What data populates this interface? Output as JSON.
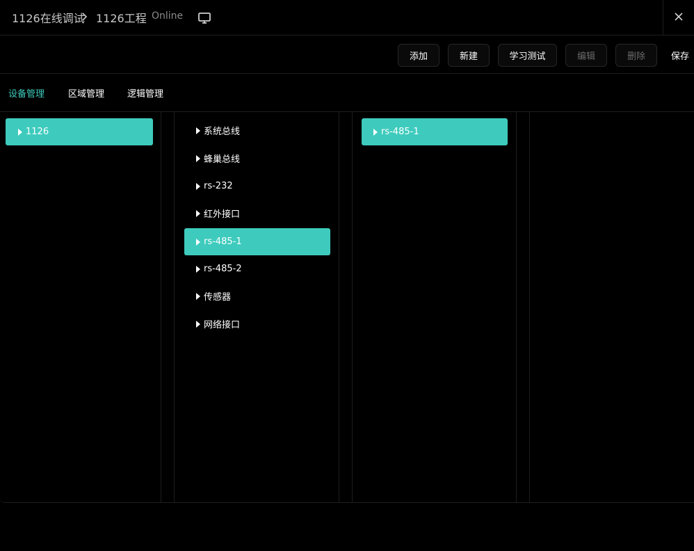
{
  "header": {
    "breadcrumb_root": "1126在线调试",
    "breadcrumb_current": "1126工程",
    "status": "Online",
    "icons": {
      "separator": "chevron-right-icon",
      "monitor": "monitor-icon",
      "close": "close-icon"
    }
  },
  "toolbar": {
    "add_label": "添加",
    "new_label": "新建",
    "learn_test_label": "学习测试",
    "edit_label": "编辑",
    "delete_label": "删除",
    "save_label": "保存"
  },
  "tabs": [
    {
      "label": "设备管理",
      "active": true
    },
    {
      "label": "区域管理",
      "active": false
    },
    {
      "label": "逻辑管理",
      "active": false
    }
  ],
  "columns": {
    "devices": [
      {
        "label": "1126",
        "selected": true
      }
    ],
    "interfaces": [
      {
        "label": "系统总线",
        "selected": false
      },
      {
        "label": "蜂巢总线",
        "selected": false
      },
      {
        "label": "rs-232",
        "selected": false
      },
      {
        "label": "红外接口",
        "selected": false
      },
      {
        "label": "rs-485-1",
        "selected": true
      },
      {
        "label": "rs-485-2",
        "selected": false
      },
      {
        "label": "传感器",
        "selected": false
      },
      {
        "label": "网络接口",
        "selected": false
      }
    ],
    "sub_items": [
      {
        "label": "rs-485-1",
        "selected": true
      }
    ]
  },
  "colors": {
    "accent": "#3ecbbd",
    "background": "#000000",
    "divider": "#1e1e1e",
    "muted_text": "#8a8a8a",
    "disabled_text": "#6a6a6a"
  }
}
